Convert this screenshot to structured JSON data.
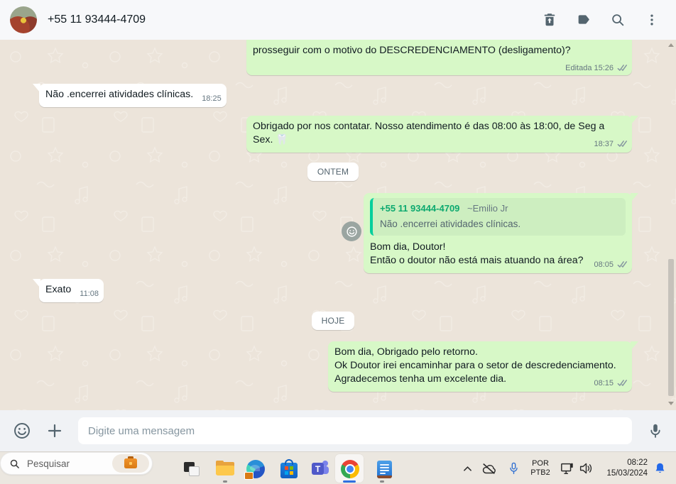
{
  "header": {
    "title": "+55 11 93444-4709"
  },
  "chat": {
    "dividers": {
      "yesterday": "ONTEM",
      "today": "HOJE"
    },
    "messages": {
      "m1": {
        "text": "prosseguir com o motivo do DESCREDENCIAMENTO (desligamento)?",
        "edited_label": "Editada",
        "time": "15:26"
      },
      "m2": {
        "text": "Não .encerrei atividades clínicas.",
        "time": "18:25"
      },
      "m3": {
        "text": "Obrigado por nos contatar. Nosso atendimento é das 08:00 às 18:00, de Seg a Sex. 🦷",
        "time": "18:37"
      },
      "m4": {
        "quote_name": "+55 11 93444-4709",
        "quote_author": "~Emilio Jr",
        "quote_text": "Não .encerrei atividades clínicas.",
        "line1": "Bom dia, Doutor!",
        "line2": "Então o doutor não está mais atuando na área?",
        "time": "08:05"
      },
      "m5": {
        "text": "Exato",
        "time": "11:08"
      },
      "m6": {
        "line1": "Bom dia, Obrigado pelo retorno.",
        "line2": "Ok Doutor irei encaminhar para o setor de descredenciamento.",
        "line3": "Agradecemos tenha um excelente dia.",
        "time": "08:15"
      }
    }
  },
  "composer": {
    "placeholder": "Digite uma mensagem"
  },
  "taskbar": {
    "search_placeholder": "Pesquisar",
    "language": {
      "line1": "POR",
      "line2": "PTB2"
    },
    "clock": {
      "time": "08:22",
      "date": "15/03/2024"
    },
    "teams_letter": "T"
  },
  "colors": {
    "outgoing_bubble": "#d7f8c7",
    "incoming_bubble": "#ffffff",
    "quote_bar": "#06cf9c",
    "quote_name": "#0ca96f",
    "checkmark": "#8696a0",
    "notification_bell": "#2368e8",
    "chat_background": "#ece4da"
  }
}
